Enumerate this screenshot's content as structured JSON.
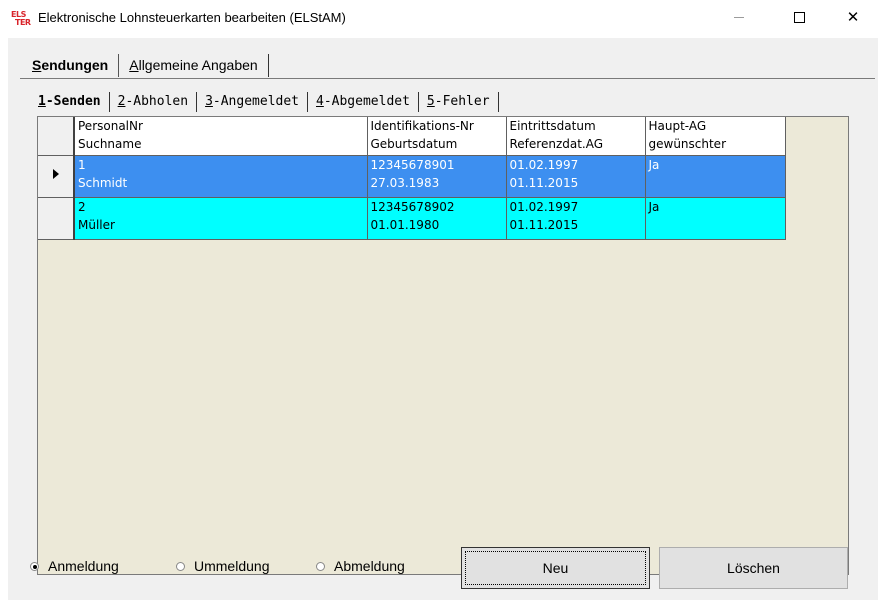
{
  "window": {
    "title": "Elektronische Lohnsteuerkarten bearbeiten (ELStAM)",
    "icon_line1": "ELS",
    "icon_line2": "TER",
    "minimize_icon": "minimize-icon",
    "maximize_icon": "maximize-icon",
    "close_symbol": "✕"
  },
  "outer_tabs": [
    {
      "label_first": "S",
      "label_rest": "endungen",
      "active": true
    },
    {
      "label_first": "A",
      "label_rest": "llgemeine Angaben",
      "active": false
    }
  ],
  "inner_tabs": [
    {
      "label_first": "1",
      "label_rest": "-Senden",
      "active": true
    },
    {
      "label_first": "2",
      "label_rest": "-Abholen",
      "active": false
    },
    {
      "label_first": "3",
      "label_rest": "-Angemeldet",
      "active": false
    },
    {
      "label_first": "4",
      "label_rest": "-Abgemeldet",
      "active": false
    },
    {
      "label_first": "5",
      "label_rest": "-Fehler",
      "active": false
    }
  ],
  "grid": {
    "headers": [
      {
        "line1": "PersonalNr",
        "line2": "Suchname"
      },
      {
        "line1": "Identifikations-Nr",
        "line2": "Geburtsdatum"
      },
      {
        "line1": "Eintrittsdatum",
        "line2": "Referenzdat.AG"
      },
      {
        "line1": "Haupt-AG",
        "line2": "gewünschter"
      }
    ],
    "rows": [
      {
        "selected": true,
        "cells": [
          {
            "line1": "1",
            "line2": "Schmidt"
          },
          {
            "line1": "12345678901",
            "line2": "27.03.1983"
          },
          {
            "line1": "01.02.1997",
            "line2": "01.11.2015"
          },
          {
            "line1": "Ja",
            "line2": ""
          }
        ]
      },
      {
        "selected": false,
        "cells": [
          {
            "line1": "2",
            "line2": "Müller"
          },
          {
            "line1": "12345678902",
            "line2": "01.01.1980"
          },
          {
            "line1": "01.02.1997",
            "line2": "01.11.2015"
          },
          {
            "line1": "Ja",
            "line2": ""
          }
        ]
      }
    ],
    "colors": {
      "selected_row": "#3d8ff0",
      "normal_row": "#00ffff",
      "empty_area": "#ece9d8"
    }
  },
  "options": {
    "radios": [
      {
        "label": "Anmeldung",
        "checked": true
      },
      {
        "label": "Ummeldung",
        "checked": false
      },
      {
        "label": "Abmeldung",
        "checked": false
      }
    ],
    "buttons": {
      "new_label": "Neu",
      "delete_label": "Löschen"
    }
  }
}
